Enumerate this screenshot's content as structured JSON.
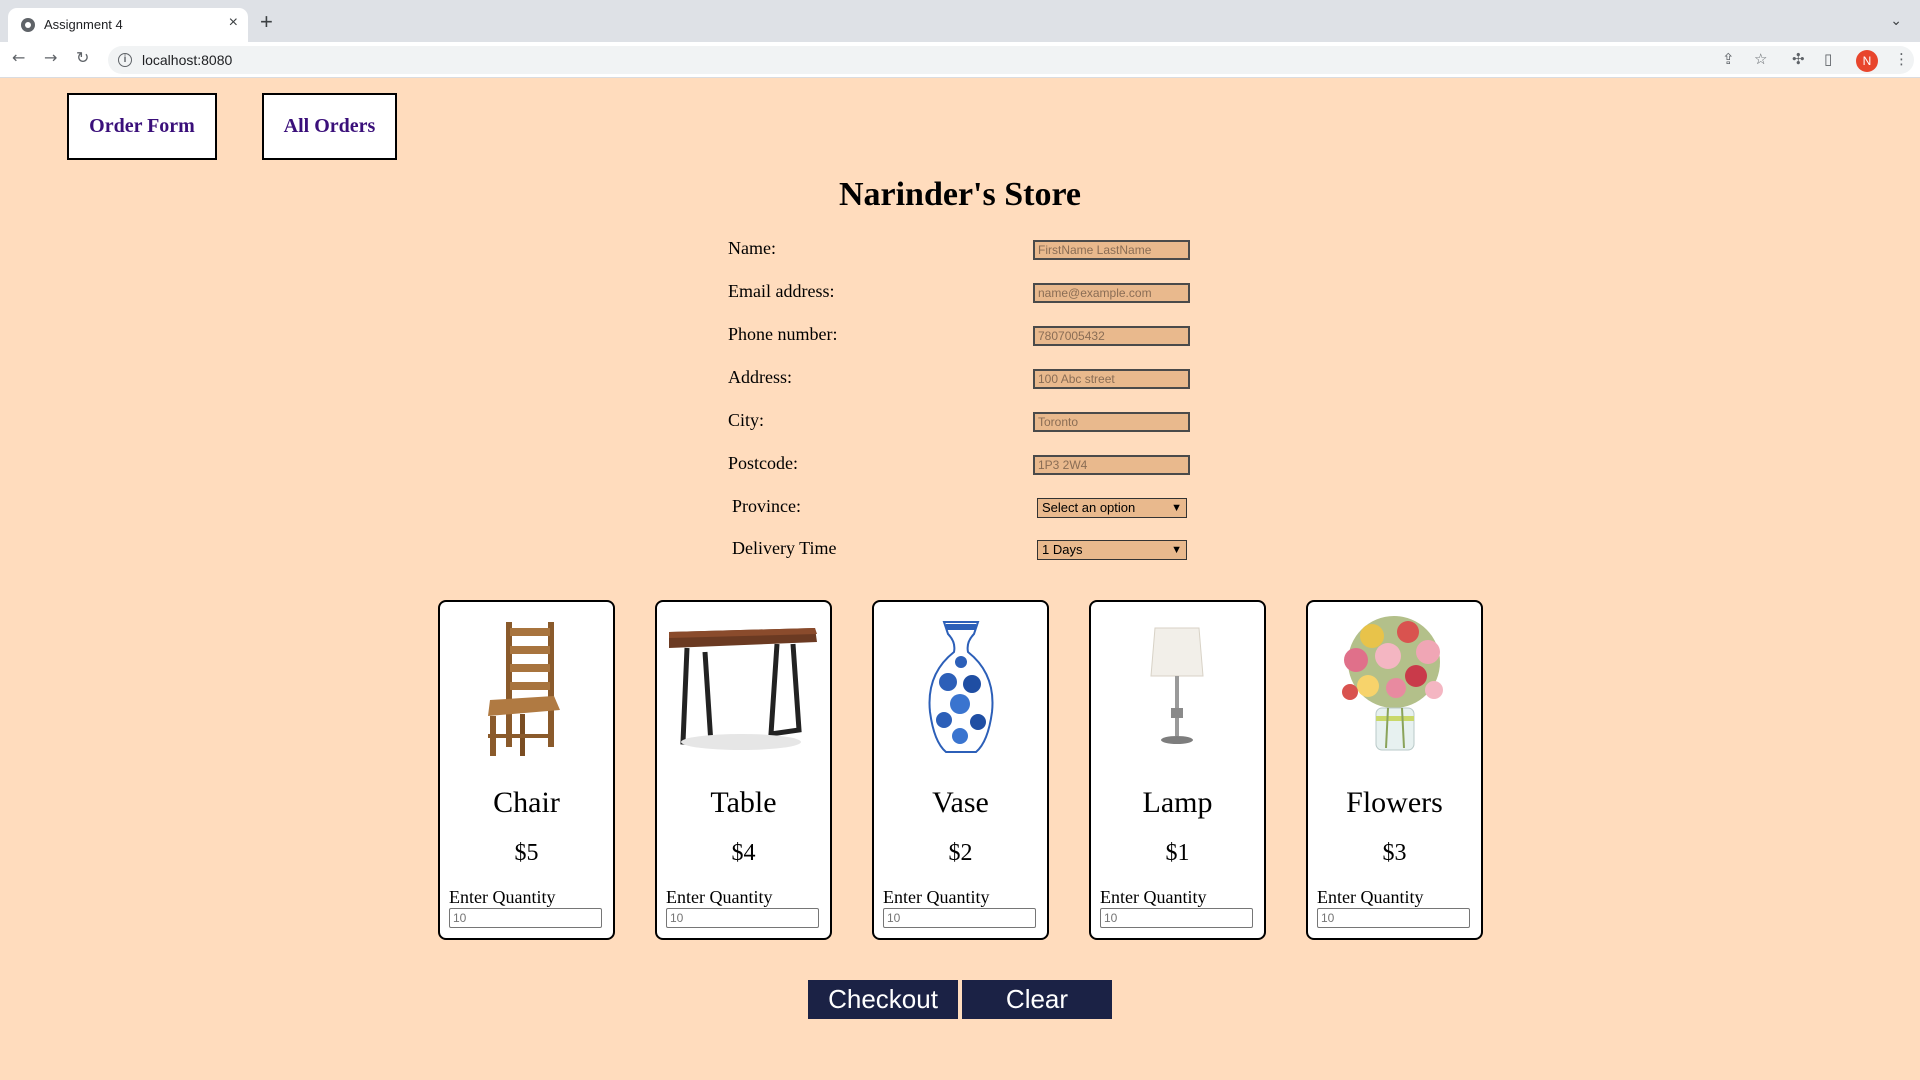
{
  "browser": {
    "tab_title": "Assignment 4",
    "url": "localhost:8080",
    "profile_initial": "N"
  },
  "nav": {
    "order_form": "Order Form",
    "all_orders": "All Orders"
  },
  "store_title": "Narinder's Store",
  "form": {
    "name": {
      "label": "Name:",
      "placeholder": "FirstName LastName"
    },
    "email": {
      "label": "Email address:",
      "placeholder": "name@example.com"
    },
    "phone": {
      "label": "Phone number:",
      "placeholder": "7807005432"
    },
    "address": {
      "label": "Address:",
      "placeholder": "100 Abc street"
    },
    "city": {
      "label": "City:",
      "placeholder": "Toronto"
    },
    "postcode": {
      "label": "Postcode:",
      "placeholder": "1P3 2W4"
    },
    "province": {
      "label": "Province:",
      "selected": "Select an option"
    },
    "delivery": {
      "label": "Delivery Time",
      "selected": "1 Days"
    }
  },
  "products": [
    {
      "name": "Chair",
      "price": "$5",
      "qty_label": "Enter Quantity",
      "qty_placeholder": "10",
      "icon": "chair-image"
    },
    {
      "name": "Table",
      "price": "$4",
      "qty_label": "Enter Quantity",
      "qty_placeholder": "10",
      "icon": "table-image"
    },
    {
      "name": "Vase",
      "price": "$2",
      "qty_label": "Enter Quantity",
      "qty_placeholder": "10",
      "icon": "vase-image"
    },
    {
      "name": "Lamp",
      "price": "$1",
      "qty_label": "Enter Quantity",
      "qty_placeholder": "10",
      "icon": "lamp-image"
    },
    {
      "name": "Flowers",
      "price": "$3",
      "qty_label": "Enter Quantity",
      "qty_placeholder": "10",
      "icon": "flowers-image"
    }
  ],
  "actions": {
    "checkout": "Checkout",
    "clear": "Clear"
  },
  "colors": {
    "page_background": "#ffdcbd",
    "input_background": "#e9b98d",
    "button_background": "#1b2245",
    "nav_text": "#3a0f7a"
  }
}
